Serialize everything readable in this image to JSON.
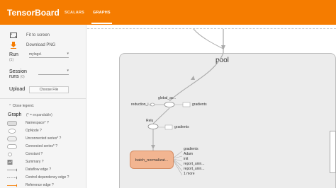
{
  "header": {
    "title": "TensorBoard",
    "tabs": [
      {
        "label": "SCALARS"
      },
      {
        "label": "GRAPHS"
      }
    ]
  },
  "sidebar": {
    "fit_label": "Fit to screen",
    "download_label": "Download PNG",
    "run": {
      "label": "Run",
      "count": "(1)",
      "value": "mylogs\\"
    },
    "session": {
      "label_line1": "Session",
      "label_line2": "runs",
      "count": "(0)",
      "value": ""
    },
    "upload": {
      "label": "Upload",
      "button": "Choose File"
    },
    "legend_toggle": "Close legend.",
    "graph": {
      "title": "Graph",
      "note": "(* = expandable)"
    },
    "legend": [
      {
        "label": "Namespace* ?"
      },
      {
        "label": "OpNode ?"
      },
      {
        "label": "Unconnected series* ?"
      },
      {
        "label": "Connected series* ?"
      },
      {
        "label": "Constant ?"
      },
      {
        "label": "Summary ?"
      },
      {
        "label": "Dataflow edge ?"
      },
      {
        "label": "Control dependency edge ?"
      },
      {
        "label": "Reference edge ?"
      }
    ]
  },
  "graph": {
    "pool_label": "pool",
    "global_label": "global_av...",
    "reduction_label": "reduction_i...",
    "gradients_1": "gradients",
    "relu_label": "Relu",
    "gradients_2": "gradients",
    "bn_label": "batch_normalizat...",
    "bn_outputs": [
      "gradients",
      "Adam",
      "init",
      "report_unin...",
      "report_unin...",
      "1 more"
    ]
  },
  "colors": {
    "accent": "#f57c00",
    "node_fill": "#f2b591",
    "pool_fill": "#ececec"
  }
}
